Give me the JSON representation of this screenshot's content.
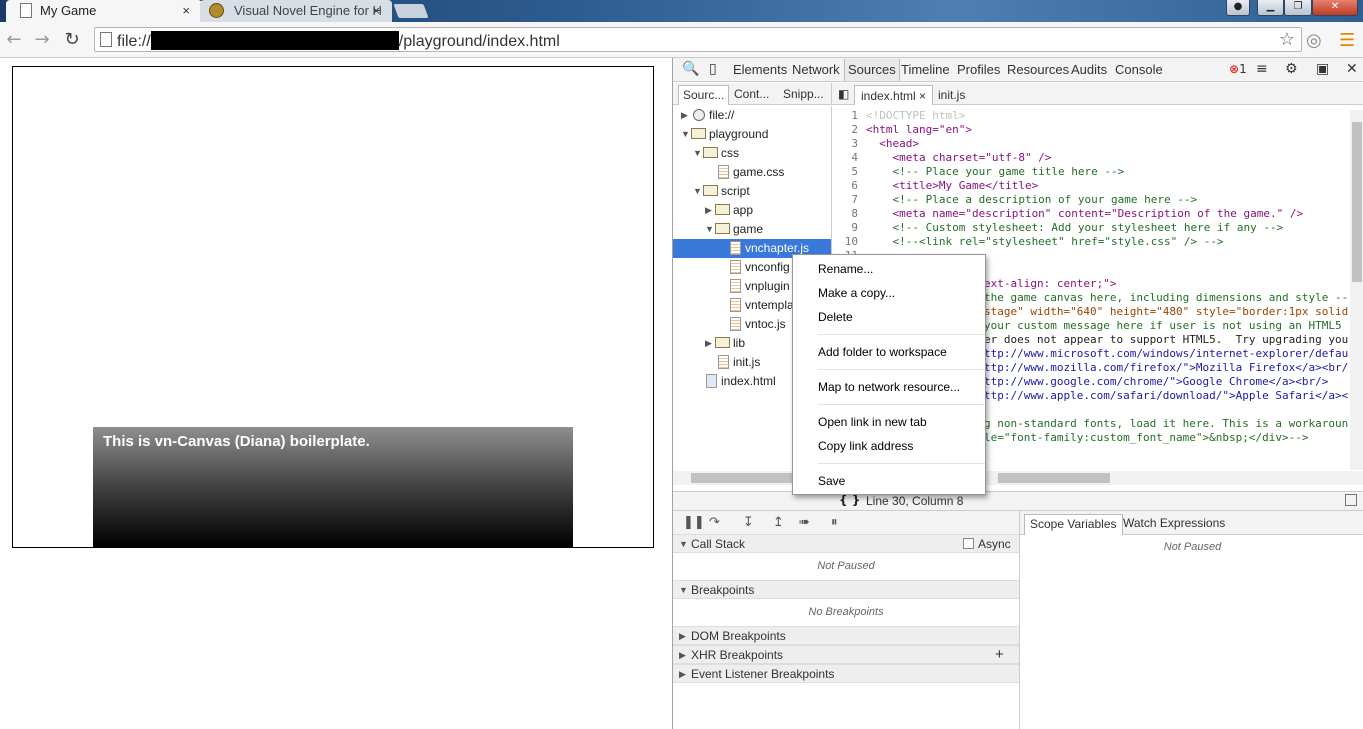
{
  "browser": {
    "tabs": [
      {
        "title": "My Game",
        "close": "×"
      },
      {
        "title": "Visual Novel Engine for H",
        "close": "×"
      }
    ],
    "window_controls": {
      "minimize": "▁",
      "maximize": "❐",
      "close": "✕"
    },
    "address": {
      "prefix": "file://",
      "suffix": "/playground/index.html"
    }
  },
  "page": {
    "dialog_text": "This is vn-Canvas (Diana) boilerplate."
  },
  "devtools": {
    "panels": [
      "Elements",
      "Network",
      "Sources",
      "Timeline",
      "Profiles",
      "Resources",
      "Audits",
      "Console"
    ],
    "selected_panel": "Sources",
    "error_count": "1",
    "navigator_tabs": [
      "Sourc...",
      "Cont...",
      "Snipp..."
    ],
    "editor_tabs": [
      {
        "label": "index.html",
        "close": "×"
      },
      {
        "label": "init.js"
      }
    ],
    "tree": [
      {
        "label": "file://",
        "arrow": "▶"
      },
      {
        "label": "playground",
        "arrow": "▼"
      },
      {
        "label": "css",
        "arrow": "▼"
      },
      {
        "label": "game.css"
      },
      {
        "label": "script",
        "arrow": "▼"
      },
      {
        "label": "app",
        "arrow": "▶"
      },
      {
        "label": "game",
        "arrow": "▼"
      },
      {
        "label": "vnchapter.js"
      },
      {
        "label": "vnconfig"
      },
      {
        "label": "vnplugin"
      },
      {
        "label": "vntempla"
      },
      {
        "label": "vntoc.js"
      },
      {
        "label": "lib",
        "arrow": "▶"
      },
      {
        "label": "init.js"
      },
      {
        "label": "index.html"
      }
    ],
    "line_numbers": [
      "1",
      "2",
      "3",
      "4",
      "5",
      "6",
      "7",
      "8",
      "9",
      "10",
      "11"
    ],
    "code_lines": [
      "<!DOCTYPE html>",
      "<html lang=\"en\">",
      "  <head>",
      "    <meta charset=\"utf-8\" />",
      "    <!-- Place your game title here -->",
      "    <title>My Game</title>",
      "    <!-- Place a description of your game here -->",
      "    <meta name=\"description\" content=\"Description of the game.\" />",
      "    <!-- Custom stylesheet: Add your stylesheet here if any -->",
      "    <!--<link rel=\"stylesheet\" href=\"style.css\" /> -->"
    ],
    "code_right_fragments": [
      "ext-align: center;\">",
      "the game canvas here, including dimensions and style --",
      "stage\" width=\"640\" height=\"480\" style=\"border:1px solid",
      "your custom message here if user is not using an HTML5",
      "er does not appear to support HTML5.  Try upgrading you",
      "ttp://www.microsoft.com/windows/internet-explorer/defau",
      "ttp://www.mozilla.com/firefox/\">Mozilla Firefox</a><br/",
      "ttp://www.google.com/chrome/\">Google Chrome</a><br/>",
      "ttp://www.apple.com/safari/download/\">Apple Safari</a><",
      "",
      "g non-standard fonts, load it here. This is a workaroun",
      "le=\"font-family:custom_font_name\">&nbsp;</div>-->"
    ],
    "status": {
      "braces": "{ }",
      "position": "Line 30, Column 8"
    },
    "sidebar_sections": {
      "call_stack": "Call Stack",
      "async": "Async",
      "call_stack_empty": "Not Paused",
      "breakpoints": "Breakpoints",
      "breakpoints_empty": "No Breakpoints",
      "dom_breakpoints": "DOM Breakpoints",
      "xhr_breakpoints": "XHR Breakpoints",
      "xhr_add": "+",
      "event_listener_breakpoints": "Event Listener Breakpoints"
    },
    "right_tabs": [
      "Scope Variables",
      "Watch Expressions"
    ],
    "right_empty": "Not Paused"
  },
  "context_menu": {
    "items": [
      "Rename...",
      "Make a copy...",
      "Delete",
      "Add folder to workspace",
      "Map to network resource...",
      "Open link in new tab",
      "Copy link address",
      "Save"
    ]
  }
}
